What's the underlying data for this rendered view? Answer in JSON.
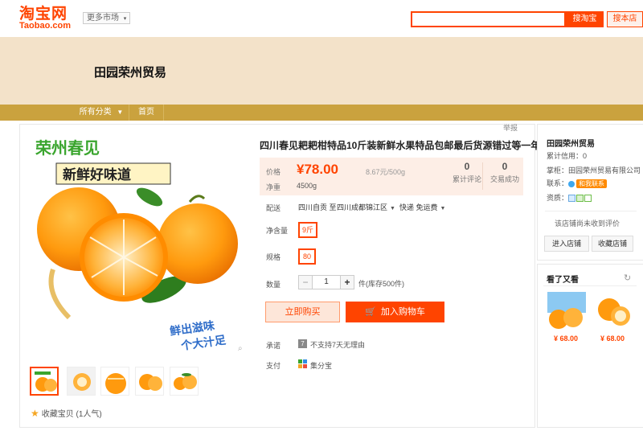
{
  "header": {
    "logo_cn": "淘宝网",
    "logo_en": "Taobao.com",
    "market_label": "更多市场",
    "search_button": "搜淘宝",
    "store_search_button": "搜本店"
  },
  "shop": {
    "name": "田园荣州贸易",
    "nav": {
      "category": "所有分类",
      "home": "首页"
    }
  },
  "product": {
    "report_label": "举报",
    "image_text_1": "荣州春见",
    "image_text_2": "新鲜好味道",
    "image_text_3": "鲜出滋味",
    "image_text_4": "个大汁足",
    "title": "四川春见耙耙柑特品10斤装新鲜水果特品包邮最后货源错过等一年",
    "price_label": "价格",
    "price": "¥78.00",
    "unit_price": "8.67元/500g",
    "weight_label": "净重",
    "weight_value": "4500g",
    "reviews_count": "0",
    "reviews_label": "累计评论",
    "sales_count": "0",
    "sales_label": "交易成功",
    "ship_label": "配送",
    "ship_from": "四川自贡 至",
    "ship_to": "四川成都锦江区",
    "ship_method": "快递 免运费",
    "net_label": "净含量",
    "net_option": "9斤",
    "spec_label": "规格",
    "spec_option": "80",
    "qty_label": "数量",
    "qty_value": "1",
    "stock_text": "件(库存500件)",
    "buy_now": "立即购买",
    "add_to_cart": "加入购物车",
    "promise_label": "承诺",
    "promise_icon_text": "7",
    "promise_text": "不支持7天无理由",
    "pay_label": "支付",
    "pay_text": "集分宝",
    "favorite_text": "收藏宝贝 (1人气)"
  },
  "sidebar": {
    "shop_name": "田园荣州贸易",
    "credit": "累计信用：0",
    "company": "掌柜：田园荣州贸易有限公司",
    "contact_label": "联系：",
    "contact_badge": "和我联系",
    "qual_label": "资质：",
    "note": "该店铺尚未收到评价",
    "enter_shop": "进入店铺",
    "collect_shop": "收藏店铺",
    "rec_title": "看了又看",
    "rec_items": [
      {
        "price": "¥ 68.00"
      },
      {
        "price": "¥ 68.00"
      }
    ]
  },
  "colors": {
    "accent": "#ff4400",
    "banner": "#f3e2c9",
    "nav": "#caa23e"
  }
}
